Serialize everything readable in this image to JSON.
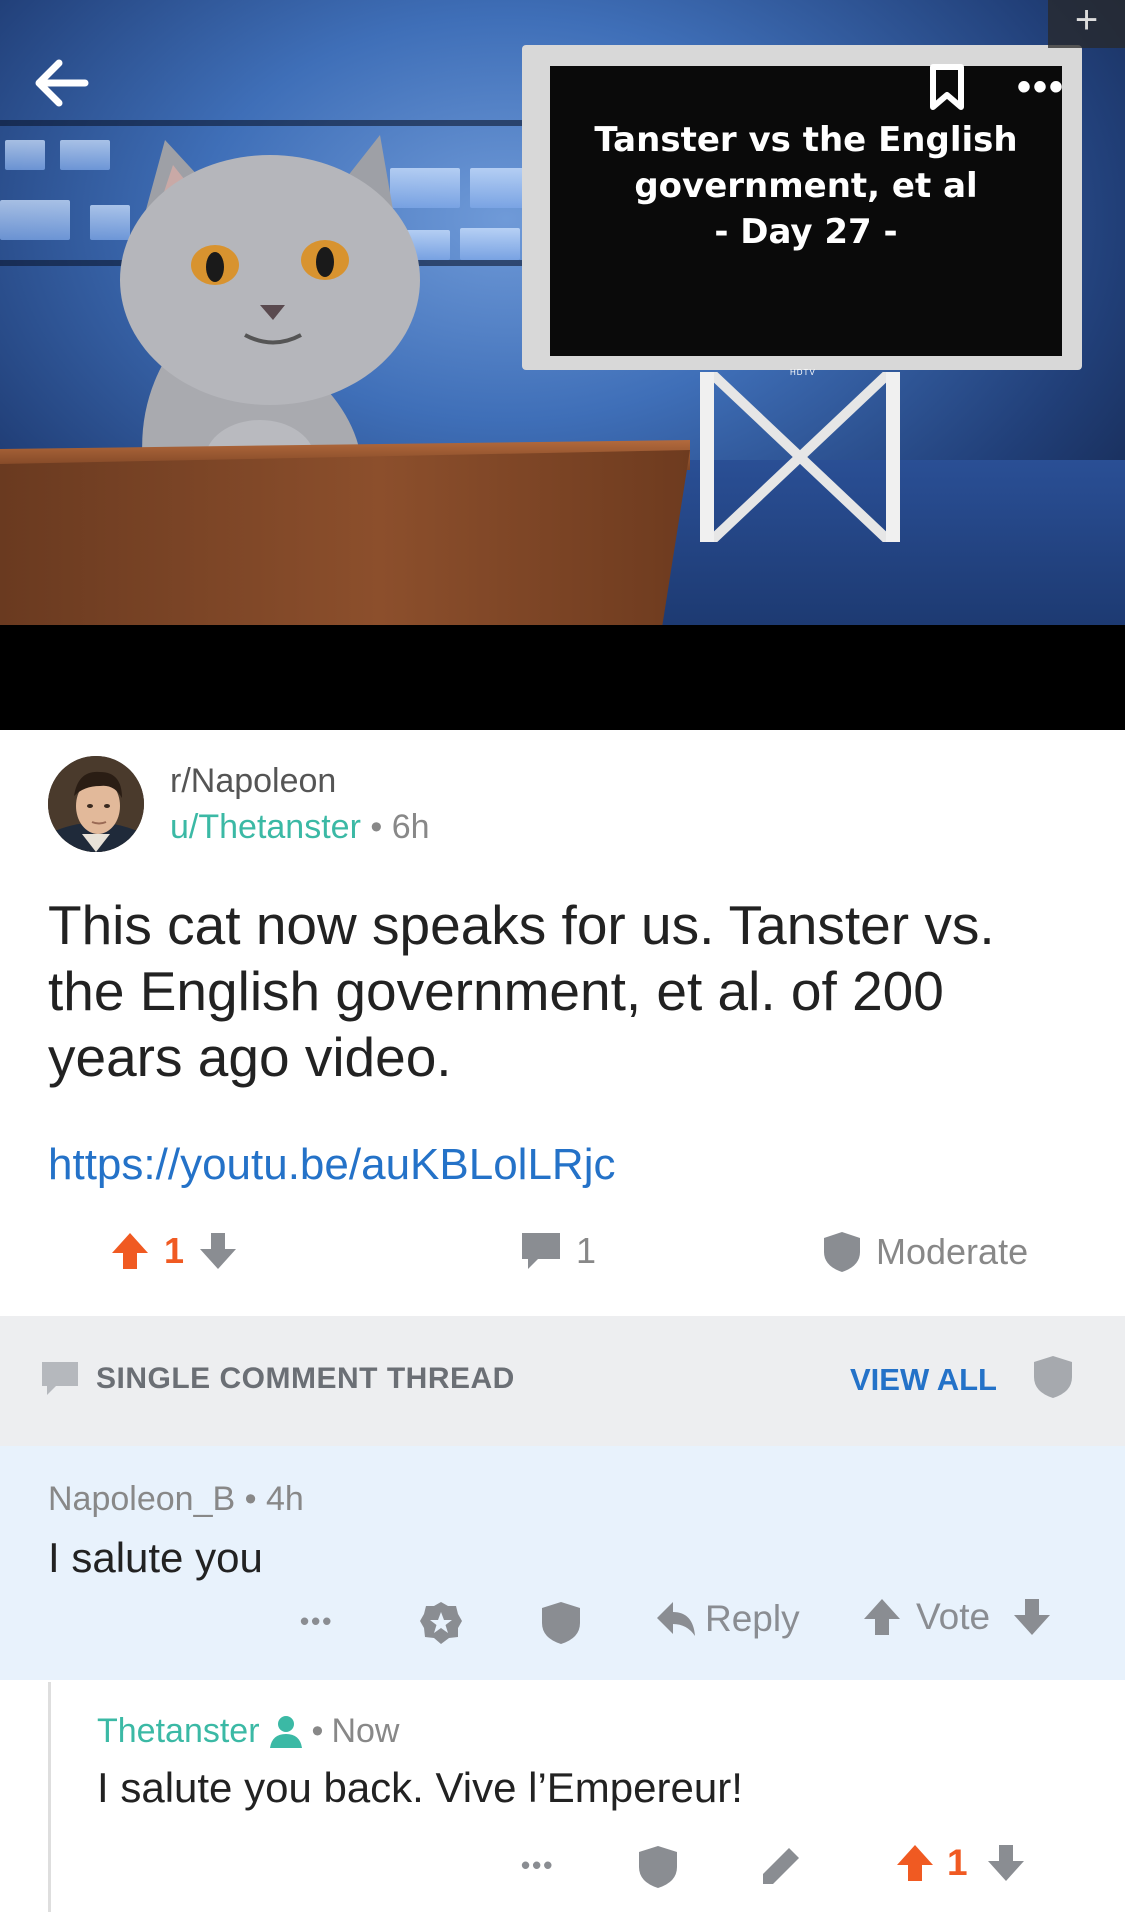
{
  "media": {
    "tv_line1": "Tanster vs the English",
    "tv_line2": "government, et al",
    "tv_line3": "- Day 27 -",
    "tv_brand": "HDTV",
    "back_icon": "arrow-left-icon",
    "bookmark_icon": "bookmark-icon",
    "more_label": "•••",
    "plus_label": "+"
  },
  "post": {
    "subreddit": "r/Napoleon",
    "author": "u/Thetanster",
    "separator": "•",
    "age": "6h",
    "title": "This cat now speaks for us. Tanster vs. the English government, et al. of 200 years ago video.",
    "link": "https://youtu.be/auKBLolLRjc",
    "score": "1",
    "comment_count": "1",
    "moderate_label": "Moderate"
  },
  "thread": {
    "label": "SINGLE COMMENT THREAD",
    "view_all": "VIEW ALL"
  },
  "comments": [
    {
      "author": "Napoleon_B",
      "separator": "•",
      "age": "4h",
      "body": "I salute you",
      "more_label": "•••",
      "reply_label": "Reply",
      "vote_label": "Vote"
    },
    {
      "author": "Thetanster",
      "separator": "•",
      "age": "Now",
      "body": "I salute you back. Vive l’Empereur!",
      "more_label": "•••",
      "score": "1"
    }
  ],
  "colors": {
    "accent_teal": "#3bb9a5",
    "link_blue": "#2472c8",
    "upvote_orange": "#f05a22",
    "icon_gray": "#8a8d92",
    "highlight_bg": "#e8f2fc"
  }
}
